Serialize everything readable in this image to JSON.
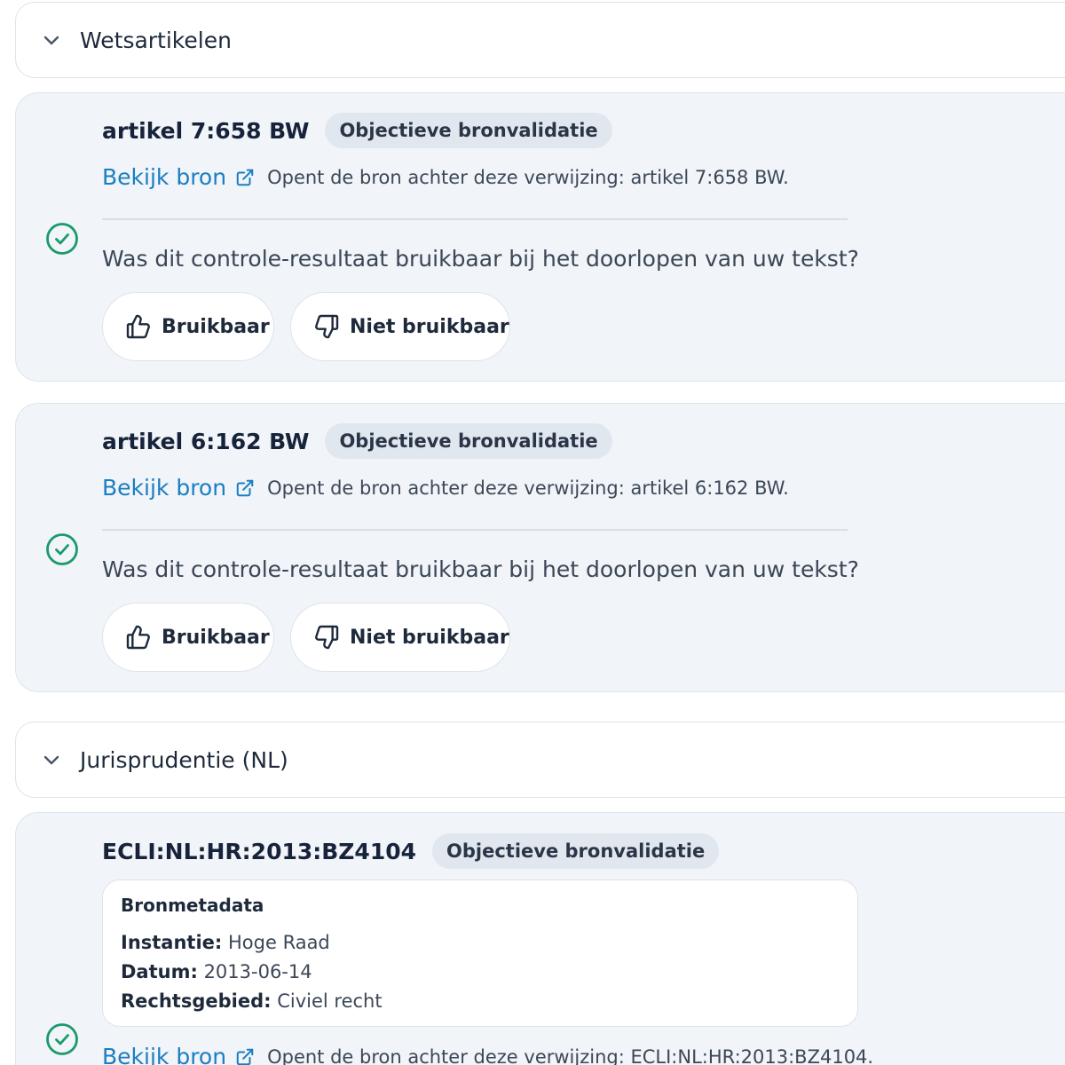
{
  "sections": [
    {
      "title": "Wetsartikelen",
      "items": [
        {
          "reference": "artikel 7:658 BW",
          "badge": "Objectieve bronvalidatie",
          "link_label": "Bekijk bron",
          "link_description": "Opent de bron achter deze verwijzing: artikel 7:658 BW.",
          "question": "Was dit controle-resultaat bruikbaar bij het doorlopen van uw tekst?",
          "useful_label": "Bruikbaar",
          "not_useful_label": "Niet bruikbaar",
          "status_icon": "check-circle-icon"
        },
        {
          "reference": "artikel 6:162 BW",
          "badge": "Objectieve bronvalidatie",
          "link_label": "Bekijk bron",
          "link_description": "Opent de bron achter deze verwijzing: artikel 6:162 BW.",
          "question": "Was dit controle-resultaat bruikbaar bij het doorlopen van uw tekst?",
          "useful_label": "Bruikbaar",
          "not_useful_label": "Niet bruikbaar",
          "status_icon": "check-circle-icon"
        }
      ]
    },
    {
      "title": "Jurisprudentie (NL)",
      "items": [
        {
          "reference": "ECLI:NL:HR:2013:BZ4104",
          "badge": "Objectieve bronvalidatie",
          "metadata": {
            "title": "Bronmetadata",
            "rows": [
              {
                "key": "Instantie:",
                "value": "Hoge Raad"
              },
              {
                "key": "Datum:",
                "value": "2013-06-14"
              },
              {
                "key": "Rechtsgebied:",
                "value": "Civiel recht"
              }
            ]
          },
          "link_label": "Bekijk bron",
          "link_description": "Opent de bron achter deze verwijzing: ECLI:NL:HR:2013:BZ4104.",
          "status_icon": "check-circle-icon"
        }
      ]
    }
  ],
  "colors": {
    "accent_link": "#1a7ec2",
    "success": "#1a9a6a",
    "card_bg": "#f1f4f8",
    "badge_bg": "#e1e7ef"
  }
}
